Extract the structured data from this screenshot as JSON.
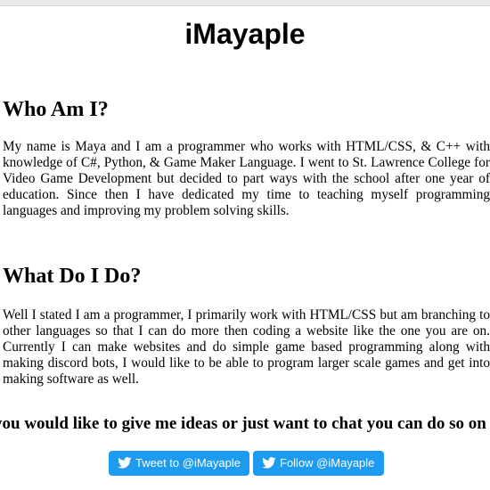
{
  "header": {
    "title": "iMayaple"
  },
  "sections": [
    {
      "heading": "Who Am I?",
      "text": "My name is Maya and I am a programmer who works with HTML/CSS, & C++ with knowledge of C#, Python, & Game Maker Language. I went to St. Lawrence College for Video Game Development but decided to part ways with the school after one year of education. Since then I have dedicated my time to teaching myself programming languages and improving my problem solving skills."
    },
    {
      "heading": "What Do I Do?",
      "text": "Well I stated I am a programmer, I primarily work with HTML/CSS but am branching to other languages so that I can do more then coding a website like the one you are on. Currently I can make websites and do simple game based programming along with making discord bots, I would like to be able to program larger scale games and get into making software as well."
    }
  ],
  "cta": {
    "text": "you would like to give me ideas or just want to chat you can do so on twitter!"
  },
  "buttons": {
    "tweet_label": "Tweet to @iMayaple",
    "follow_label": "Follow @iMayaple",
    "icon": "twitter-bird-icon",
    "color": "#1d9bf0"
  }
}
